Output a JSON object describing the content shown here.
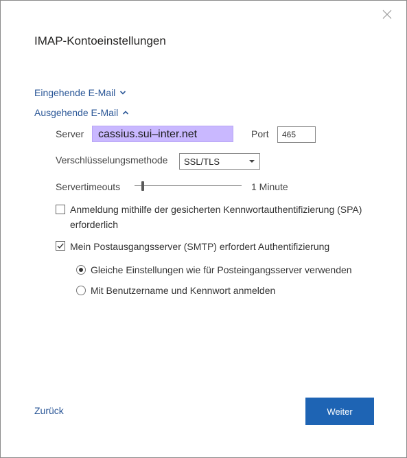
{
  "dialog": {
    "title": "IMAP-Kontoeinstellungen"
  },
  "incoming": {
    "label": "Eingehende E-Mail",
    "icon": "chevron-down-icon"
  },
  "outgoing": {
    "label": "Ausgehende E-Mail",
    "icon": "chevron-up-icon",
    "server_label": "Server",
    "server_value": "cassius.sui–inter.net",
    "port_label": "Port",
    "port_value": "465",
    "encryption_label": "Verschlüsselungsmethode",
    "encryption_value": "SSL/TLS",
    "timeout_label": "Servertimeouts",
    "timeout_value": "1 Minute",
    "spa_label": "Anmeldung mithilfe der gesicherten Kennwortauthentifizierung (SPA) erforderlich",
    "spa_checked": false,
    "smtp_auth_label": "Mein Postausgangsserver (SMTP) erfordert Authentifizierung",
    "smtp_auth_checked": true,
    "auth_options": [
      {
        "label": "Gleiche Einstellungen wie für Posteingangsserver verwenden",
        "selected": true
      },
      {
        "label": "Mit Benutzername und Kennwort anmelden",
        "selected": false
      }
    ]
  },
  "footer": {
    "back_label": "Zurück",
    "next_label": "Weiter"
  },
  "colors": {
    "link": "#2b5797",
    "primary": "#1e64b4",
    "highlight": "#c9b8ff"
  }
}
